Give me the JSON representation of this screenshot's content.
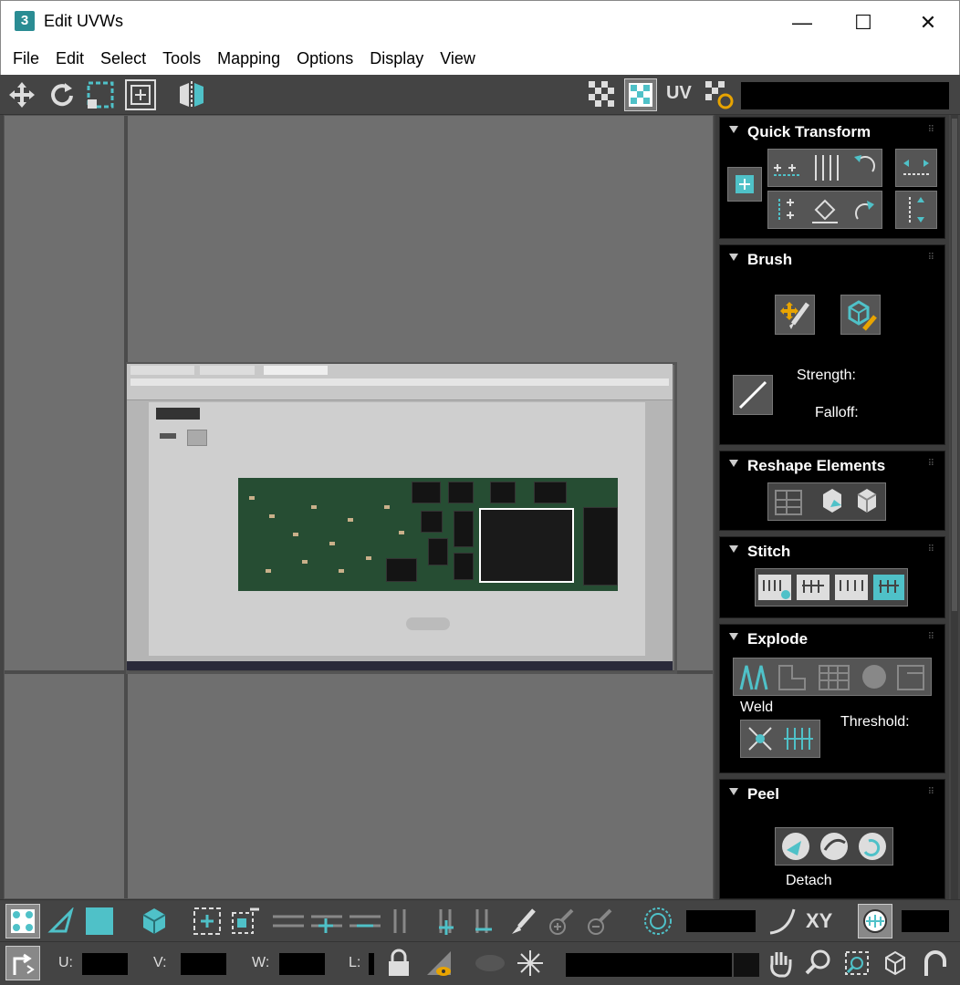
{
  "window": {
    "title": "Edit UVWs",
    "app_icon": "3",
    "minimize": "—",
    "maximize": "☐",
    "close": "✕"
  },
  "menu": [
    "File",
    "Edit",
    "Select",
    "Tools",
    "Mapping",
    "Options",
    "Display",
    "View"
  ],
  "toolbar": {
    "uv_label": "UV"
  },
  "panel": {
    "quick_transform": "Quick Transform",
    "brush": {
      "title": "Brush",
      "strength": "Strength:",
      "falloff": "Falloff:"
    },
    "reshape": "Reshape Elements",
    "stitch": "Stitch",
    "explode": {
      "title": "Explode",
      "weld": "Weld",
      "threshold": "Threshold:"
    },
    "peel": {
      "title": "Peel",
      "detach": "Detach"
    }
  },
  "bottom": {
    "xy": "XY",
    "u_label": "U:",
    "v_label": "V:",
    "w_label": "W:",
    "l_label": "L:"
  },
  "colors": {
    "accent": "#4fc1c8",
    "panel_bg": "#000000",
    "viewport_bg": "#6f6f6f",
    "chrome": "#444444"
  }
}
